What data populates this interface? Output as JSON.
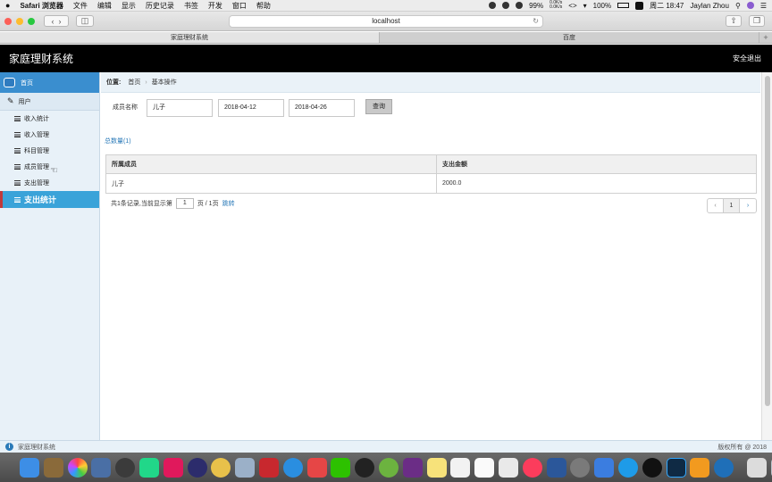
{
  "menubar": {
    "apple": "",
    "items": [
      "Safari 浏览器",
      "文件",
      "编辑",
      "显示",
      "历史记录",
      "书签",
      "开发",
      "窗口",
      "帮助"
    ],
    "battery": "99%",
    "net_up": "0.0K/s",
    "net_down": "0.0K/s",
    "battery2": "100%",
    "time": "周二 18:47",
    "user": "Jaylan Zhou"
  },
  "browser": {
    "url": "localhost",
    "tabs": [
      "家庭理财系统",
      "百度"
    ],
    "add_tab": "+"
  },
  "app": {
    "title": "家庭理财系统",
    "logout": "安全退出"
  },
  "sidebar": {
    "home": "首页",
    "group": "用户",
    "items": [
      "收入统计",
      "收入管理",
      "科目管理",
      "成员管理",
      "支出管理",
      "支出统计"
    ]
  },
  "breadcrumb": {
    "label": "位置:",
    "home": "首页",
    "sep": "›",
    "current": "基本操作"
  },
  "search": {
    "member_label": "成员名称",
    "member_value": "儿子",
    "start_date": "2018-04-12",
    "end_date": "2018-04-26",
    "query_button": "查询"
  },
  "total": "总数量(1)",
  "table": {
    "headers": [
      "所属成员",
      "支出金额"
    ],
    "rows": [
      [
        "儿子",
        "2000.0"
      ]
    ]
  },
  "pager": {
    "summary": "共1条记录,当前显示第",
    "page_value": "1",
    "page_of": "页 / 1页",
    "jump": "跳转",
    "prev": "‹",
    "current": "1",
    "next": "›"
  },
  "footer": {
    "name": "家庭理财系统",
    "copyright": "版权所有 @ 2018"
  },
  "colors": {
    "header_bg": "#000000",
    "sidebar_bg": "#e8f1f8",
    "active_item": "#3aa3d9",
    "home_item": "#3a8ecf",
    "link": "#2a7ab8"
  }
}
